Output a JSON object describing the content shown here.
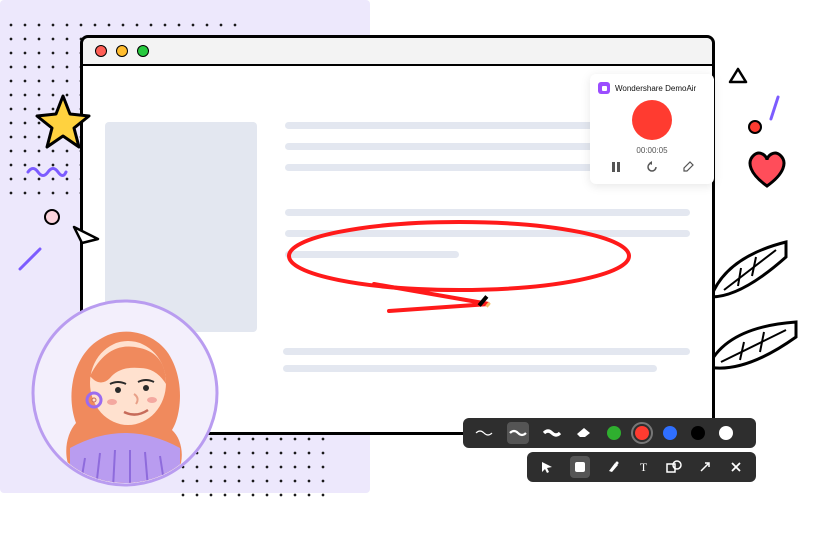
{
  "recording": {
    "app_label": "Wondershare DemoAir",
    "timer": "00:00:05",
    "controls": {
      "pause": "pause-icon",
      "restart": "restart-icon",
      "edit": "edit-icon"
    }
  },
  "toolbar_draw": {
    "items": [
      "wave-thin",
      "wave-med",
      "wave-thick",
      "eraser"
    ],
    "colors": [
      "green",
      "red",
      "blue",
      "black",
      "white"
    ],
    "active_color": "red",
    "active_stroke": "wave-med"
  },
  "toolbar_shape": {
    "items": [
      "pointer",
      "rectangle",
      "highlight",
      "text",
      "shape",
      "arrow",
      "close"
    ],
    "active": "rectangle"
  },
  "window": {
    "buttons": [
      "close",
      "minimize",
      "maximize"
    ]
  }
}
